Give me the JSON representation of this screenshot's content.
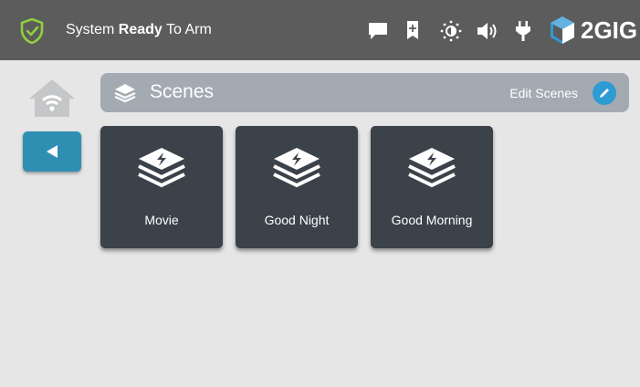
{
  "statusbar": {
    "status_prefix": "System",
    "status_bold": "Ready",
    "status_suffix": "To Arm",
    "shield_color": "#8fcf3f",
    "icons": [
      "message-icon",
      "bookmark-add-icon",
      "brightness-icon",
      "volume-icon",
      "plug-icon"
    ],
    "logo_text": "2GIG",
    "logo_accent": "#2e9bd3"
  },
  "nav": {
    "home_icon": "home-wifi-icon",
    "back_icon": "back-arrow-icon",
    "back_color": "#2f8fb3"
  },
  "scenes_header": {
    "title": "Scenes",
    "edit_label": "Edit Scenes",
    "edit_icon": "pencil-icon"
  },
  "scenes": [
    {
      "label": "Movie",
      "icon": "layers-bolt-icon"
    },
    {
      "label": "Good Night",
      "icon": "layers-bolt-icon"
    },
    {
      "label": "Good Morning",
      "icon": "layers-bolt-icon"
    }
  ]
}
